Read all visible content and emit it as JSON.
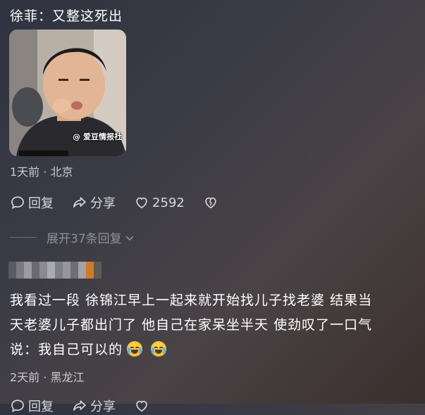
{
  "post": {
    "title": "徐菲：又整这死出",
    "image_watermark": "@ 爱豆情报社",
    "meta": "1天前 · 北京",
    "actions": {
      "reply_label": "回复",
      "share_label": "分享",
      "like_count": "2592"
    }
  },
  "expand_replies_label": "展开37条回复",
  "comment": {
    "username_blurred": true,
    "text_line1": "我看过一段 徐锦江早上一起来就开始找儿子找老婆 结果当",
    "text_line2": "天老婆儿子都出门了 他自己在家呆坐半天 使劲叹了一口气",
    "text_line3": "说：我自己可以的",
    "meta": "2天前 · 黑龙江",
    "actions": {
      "reply_label": "回复",
      "share_label": "分享"
    }
  },
  "colors": {
    "text_primary": "#ffffff",
    "text_secondary": "#c9c9cc",
    "text_muted": "#8f9096"
  }
}
